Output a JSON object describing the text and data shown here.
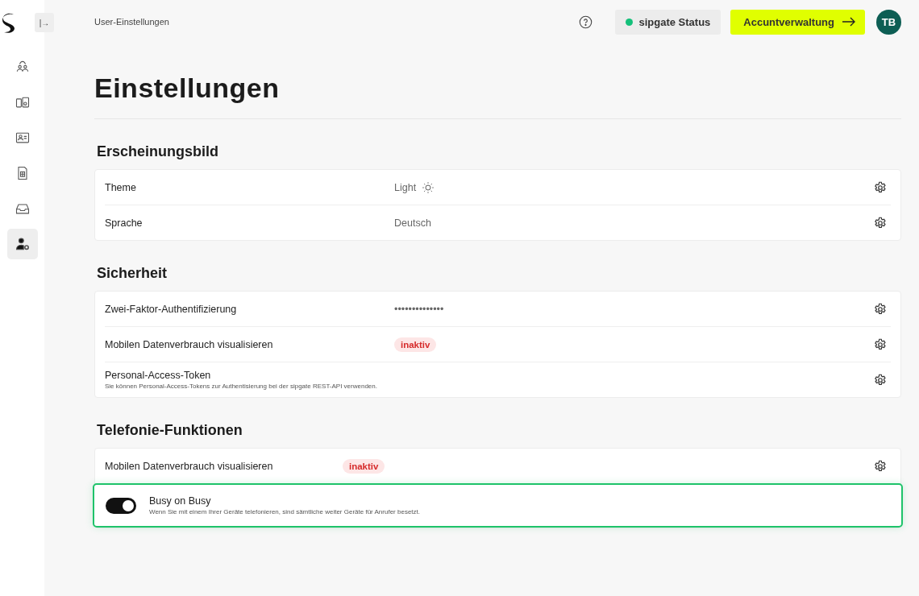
{
  "sidebar": {
    "collapse_button": "|→",
    "items": [
      {
        "kind": "people",
        "selected": false
      },
      {
        "kind": "devices",
        "selected": false
      },
      {
        "kind": "contacts",
        "selected": false
      },
      {
        "kind": "sim",
        "selected": false
      },
      {
        "kind": "inbox",
        "selected": false
      },
      {
        "kind": "user",
        "selected": true
      }
    ]
  },
  "header": {
    "breadcrumb": "User-Einstellungen",
    "status_button": {
      "label": "sipgate Status",
      "color": "#14c07a"
    },
    "account_button": "Accuntverwaltung",
    "avatar": "TB"
  },
  "page_title": "Einstellungen",
  "sections": [
    {
      "title": "Erscheinungsbild",
      "rows": [
        {
          "kind": "theme",
          "label": "Theme",
          "value": "Light"
        },
        {
          "kind": "text",
          "label": "Sprache",
          "value": "Deutsch"
        }
      ]
    },
    {
      "title": "Sicherheit",
      "rows": [
        {
          "kind": "text",
          "label": "Zwei-Faktor-Authentifizierung",
          "value": "••••••••••••••"
        },
        {
          "kind": "badge",
          "label": "Mobilen Datenverbrauch visualisieren",
          "value": "inaktiv"
        },
        {
          "kind": "described",
          "label": "Personal-Access-Token",
          "description": "Sie können Personal-Access-Tokens zur Authentisierung bei der sipgate REST-API verwenden."
        }
      ]
    },
    {
      "title": "Telefonie-Funktionen",
      "rows": [
        {
          "kind": "badge",
          "label": "Mobilen Datenverbrauch visualisieren",
          "value": "inaktiv"
        },
        {
          "kind": "toggle",
          "label": "Busy on Busy",
          "description": "Wenn Sie mit einem Ihrer Geräte telefonieren, sind sämtliche weiter Geräte für Anrufer besetzt.",
          "on": true,
          "highlighted": true
        }
      ]
    }
  ]
}
